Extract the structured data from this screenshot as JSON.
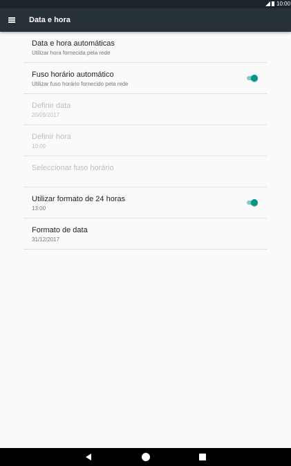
{
  "status_bar": {
    "time": "10:00",
    "icons": [
      "signal-icon",
      "battery-icon"
    ]
  },
  "app_bar": {
    "title": "Data e hora",
    "menu_icon": "menu-icon"
  },
  "settings": [
    {
      "title": "Data e hora automáticas",
      "subtitle": "Utilizar hora fornecida pela rede",
      "enabled": true,
      "toggle": null
    },
    {
      "title": "Fuso horário automático",
      "subtitle": "Utilizar fuso horário fornecido pela rede",
      "enabled": true,
      "toggle": true
    },
    {
      "title": "Definir data",
      "subtitle": "20/09/2017",
      "enabled": false,
      "toggle": null
    },
    {
      "title": "Definir hora",
      "subtitle": "10:00",
      "enabled": false,
      "toggle": null
    },
    {
      "title": "Seleccionar fuso horário",
      "subtitle": "",
      "enabled": false,
      "toggle": null
    },
    {
      "title": "Utilizar formato de 24 horas",
      "subtitle": "13:00",
      "enabled": true,
      "toggle": true
    },
    {
      "title": "Formato de data",
      "subtitle": "31/12/2017",
      "enabled": true,
      "toggle": null
    }
  ],
  "colors": {
    "app_bar": "#263238",
    "status_bar": "#1b2429",
    "accent": "#009688",
    "accent_track": "#80cbc4",
    "background": "#fafafa",
    "disabled_text": "#bdbdbd"
  },
  "nav_bar": {
    "buttons": [
      "back-icon",
      "home-icon",
      "recent-apps-icon"
    ]
  }
}
